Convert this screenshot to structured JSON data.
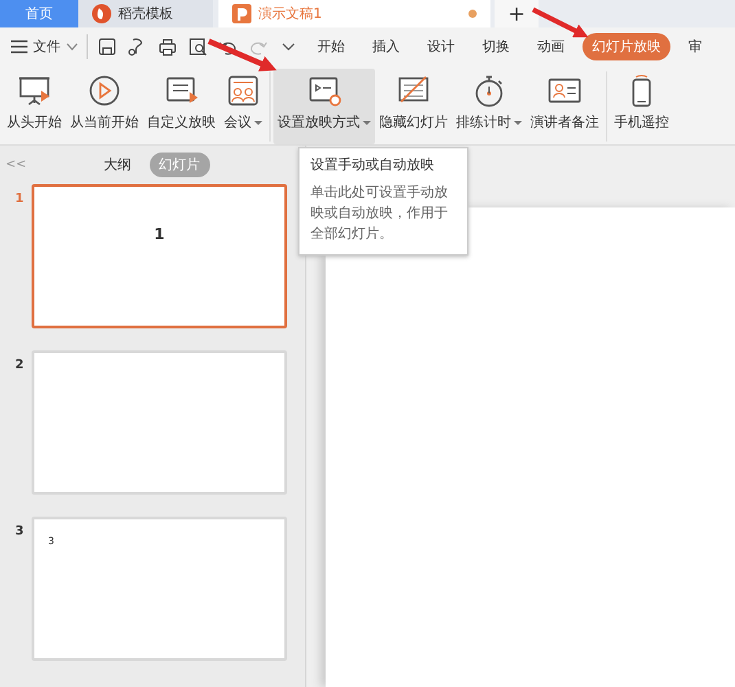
{
  "title_tabs": [
    {
      "label": "首页",
      "kind": "home",
      "selected": false
    },
    {
      "label": "稻壳模板",
      "kind": "docer",
      "selected": false
    },
    {
      "label": "演示文稿1",
      "kind": "doc",
      "selected": true,
      "unsaved": true
    }
  ],
  "new_tab": "+",
  "menu": {
    "file": "文件",
    "tabs": [
      {
        "label": "开始",
        "selected": false
      },
      {
        "label": "插入",
        "selected": false
      },
      {
        "label": "设计",
        "selected": false
      },
      {
        "label": "切换",
        "selected": false
      },
      {
        "label": "动画",
        "selected": false
      },
      {
        "label": "幻灯片放映",
        "selected": true
      },
      {
        "label": "审",
        "selected": false
      }
    ]
  },
  "ribbon": [
    {
      "label": "从头开始",
      "kind": "screen",
      "dropdown": false,
      "highlighted": false
    },
    {
      "label": "从当前开始",
      "kind": "play",
      "dropdown": false,
      "highlighted": false
    },
    {
      "label": "自定义放映",
      "kind": "custom",
      "dropdown": false,
      "highlighted": false
    },
    {
      "label": "会议",
      "kind": "meeting",
      "dropdown": true,
      "highlighted": false,
      "group_end": true
    },
    {
      "label": "设置放映方式",
      "kind": "setup",
      "dropdown": true,
      "highlighted": true
    },
    {
      "label": "隐藏幻灯片",
      "kind": "hide",
      "dropdown": false,
      "highlighted": false
    },
    {
      "label": "排练计时",
      "kind": "timer",
      "dropdown": true,
      "highlighted": false
    },
    {
      "label": "演讲者备注",
      "kind": "notes",
      "dropdown": false,
      "highlighted": false,
      "group_end": true
    },
    {
      "label": "手机遥控",
      "kind": "phone",
      "dropdown": false,
      "highlighted": false
    }
  ],
  "tooltip": {
    "title": "设置手动或自动放映",
    "body": "单击此处可设置手动放映或自动放映，作用于全部幻灯片。"
  },
  "panel": {
    "collapse": "<<",
    "views": [
      {
        "label": "大纲",
        "selected": false
      },
      {
        "label": "幻灯片",
        "selected": true
      }
    ],
    "slides": [
      {
        "number": "1",
        "selected": true,
        "title": "1"
      },
      {
        "number": "2",
        "selected": false
      },
      {
        "number": "3",
        "selected": false,
        "text": "3"
      }
    ]
  }
}
